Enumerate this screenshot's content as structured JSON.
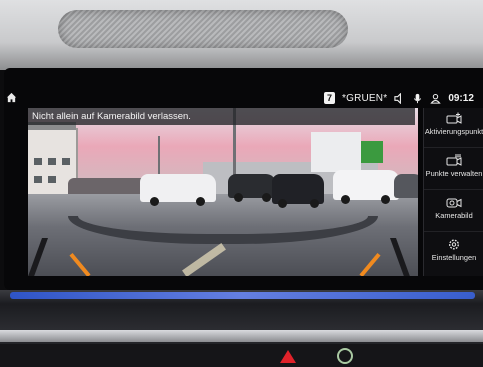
{
  "status": {
    "track": "7",
    "station": "*GRUEN*",
    "clock": "09:12"
  },
  "camera": {
    "warning": "Nicht allein auf Kamerabild verlassen."
  },
  "side_menu": {
    "items": [
      {
        "label": "Aktivierungspunkt",
        "icon": "camera-add-icon"
      },
      {
        "label": "Punkte verwalten",
        "icon": "camera-list-icon"
      },
      {
        "label": "Kamerabild",
        "icon": "camera-icon"
      },
      {
        "label": "Einstellungen",
        "icon": "gear-icon"
      }
    ]
  },
  "colors": {
    "guide_orange": "#f08a1f",
    "ambient_blue": "#2f5be0",
    "hazard_red": "#e0222a"
  }
}
